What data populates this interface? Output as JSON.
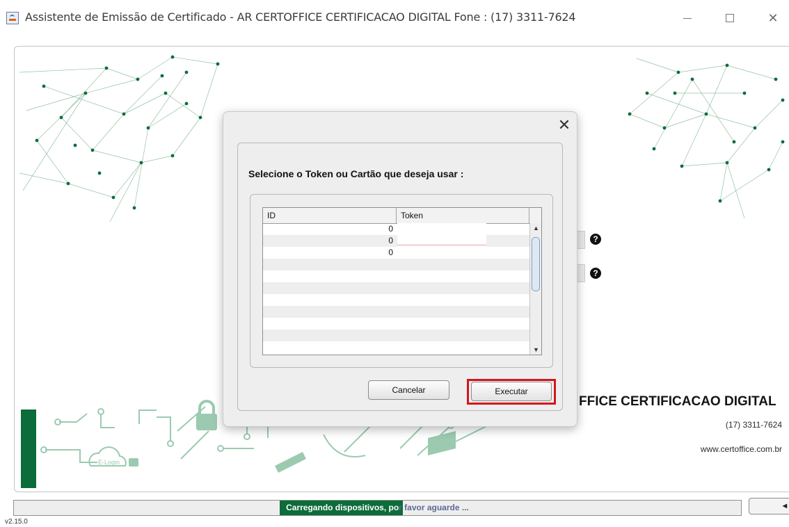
{
  "window": {
    "title": "Assistente de Emissão de Certificado - AR CERTOFFICE CERTIFICACAO DIGITAL Fone : (17) 3311-7624",
    "controls": {
      "minimize": "",
      "maximize": "",
      "close": "✕"
    }
  },
  "background": {
    "company_name": "FFICE CERTIFICACAO DIGITAL",
    "phone": "(17) 3311-7624",
    "website": "www.certoffice.com.br",
    "help_glyph": "?",
    "logo_text": "E-Login"
  },
  "dialog": {
    "close": "✕",
    "heading": "Selecione o Token ou Cartão que deseja usar :",
    "table": {
      "columns": [
        "ID",
        "Token"
      ],
      "rows": [
        {
          "id": "0",
          "token": ""
        },
        {
          "id": "0",
          "token": ""
        },
        {
          "id": "0",
          "token": ""
        },
        {
          "id": "",
          "token": ""
        },
        {
          "id": "",
          "token": ""
        },
        {
          "id": "",
          "token": ""
        },
        {
          "id": "",
          "token": ""
        },
        {
          "id": "",
          "token": ""
        },
        {
          "id": "",
          "token": ""
        },
        {
          "id": "",
          "token": ""
        },
        {
          "id": "",
          "token": ""
        }
      ],
      "scroll_up": "▲",
      "scroll_down": "▼"
    },
    "buttons": {
      "cancel": "Cancelar",
      "execute": "Executar"
    }
  },
  "status": {
    "message_dark": "Carregando dispositivos, po",
    "message_light": "r favor aguarde ...",
    "version": "v2.15.0"
  },
  "colors": {
    "brand_green": "#0c6c3a",
    "highlight_red": "#d4141b",
    "status_text": "#5a6a94"
  }
}
